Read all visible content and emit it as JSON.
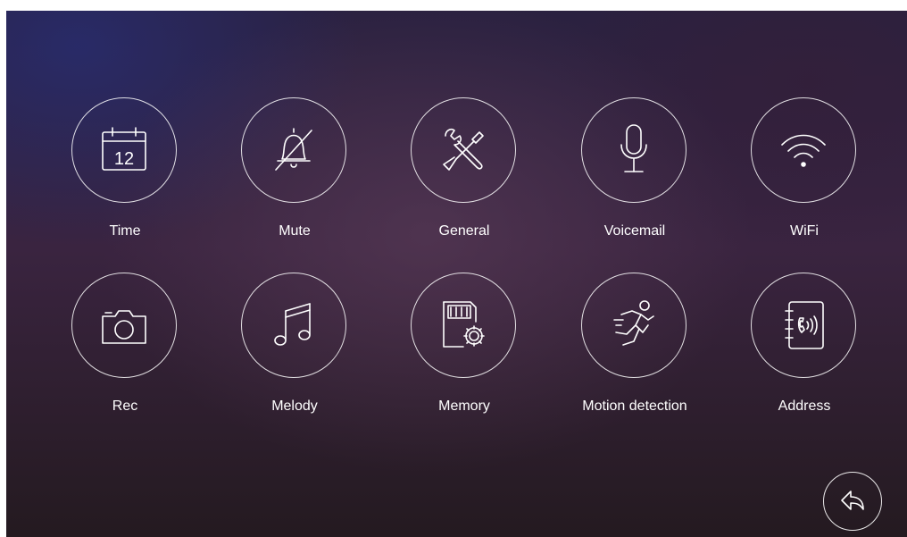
{
  "menu": {
    "items": [
      {
        "id": "time",
        "label": "Time",
        "icon": "calendar-icon"
      },
      {
        "id": "mute",
        "label": "Mute",
        "icon": "bell-off-icon"
      },
      {
        "id": "general",
        "label": "General",
        "icon": "tools-icon"
      },
      {
        "id": "voicemail",
        "label": "Voicemail",
        "icon": "microphone-icon"
      },
      {
        "id": "wifi",
        "label": "WiFi",
        "icon": "wifi-icon"
      },
      {
        "id": "rec",
        "label": "Rec",
        "icon": "camera-icon"
      },
      {
        "id": "melody",
        "label": "Melody",
        "icon": "music-note-icon"
      },
      {
        "id": "memory",
        "label": "Memory",
        "icon": "sd-card-settings-icon"
      },
      {
        "id": "motion",
        "label": "Motion detection",
        "icon": "running-person-icon"
      },
      {
        "id": "address",
        "label": "Address",
        "icon": "address-book-icon"
      }
    ],
    "calendar_day": "12"
  },
  "back": {
    "icon": "back-arrow-icon"
  }
}
